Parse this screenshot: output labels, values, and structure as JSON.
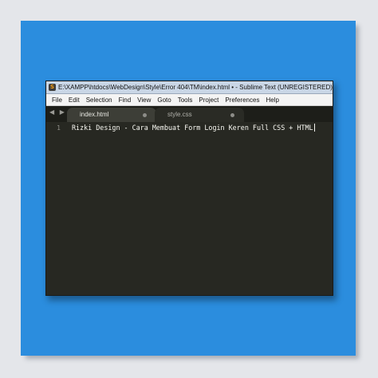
{
  "window": {
    "title": "E:\\XAMPP\\htdocs\\WebDesign\\Style\\Error 404\\TM\\index.html • - Sublime Text (UNREGISTERED)",
    "app_icon": "sublime-logo-icon"
  },
  "menu": [
    "File",
    "Edit",
    "Selection",
    "Find",
    "View",
    "Goto",
    "Tools",
    "Project",
    "Preferences",
    "Help"
  ],
  "tabs": [
    {
      "label": "index.html",
      "active": true
    },
    {
      "label": "style.css",
      "active": false
    }
  ],
  "nav": {
    "arrows": "◀ ▶"
  },
  "editor": {
    "line_number": "1",
    "code": "Rizki Design - Cara Membuat Form Login Keren Full CSS + HTML"
  },
  "colors": {
    "frame": "#2b8dde",
    "editor_bg": "#272822",
    "tabbar_bg": "#1d1e19",
    "text": "#f8f8f2"
  }
}
